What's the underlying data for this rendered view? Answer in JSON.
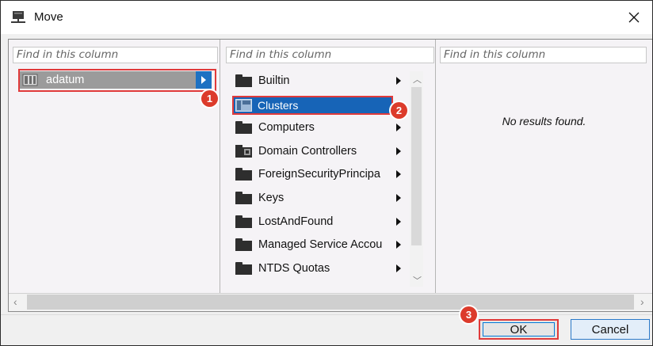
{
  "window": {
    "title": "Move",
    "icon": "server-tree-icon",
    "close_icon": "close-icon"
  },
  "columns": {
    "col1": {
      "search_placeholder": "Find in this column",
      "items": [
        {
          "label": "adatum",
          "icon": "domain-icon",
          "selected": true,
          "has_children": true
        }
      ]
    },
    "col2": {
      "search_placeholder": "Find in this column",
      "items": [
        {
          "label": "Builtin",
          "icon": "folder-icon"
        },
        {
          "label": "Clusters",
          "icon": "container-icon",
          "selected": true
        },
        {
          "label": "Computers",
          "icon": "folder-icon"
        },
        {
          "label": "Domain Controllers",
          "icon": "ou-icon"
        },
        {
          "label": "ForeignSecurityPrincipa",
          "icon": "folder-icon"
        },
        {
          "label": "Keys",
          "icon": "folder-icon"
        },
        {
          "label": "LostAndFound",
          "icon": "folder-icon"
        },
        {
          "label": "Managed Service Accou",
          "icon": "folder-icon"
        },
        {
          "label": "NTDS Quotas",
          "icon": "folder-icon"
        }
      ]
    },
    "col3": {
      "search_placeholder": "Find in this column",
      "empty_text": "No results found."
    }
  },
  "badges": [
    "1",
    "2",
    "3"
  ],
  "buttons": {
    "ok": "OK",
    "cancel": "Cancel"
  },
  "colors": {
    "selection_blue": "#1764b7",
    "highlight_red": "#e03a3a",
    "badge_red": "#dc3b2b"
  }
}
